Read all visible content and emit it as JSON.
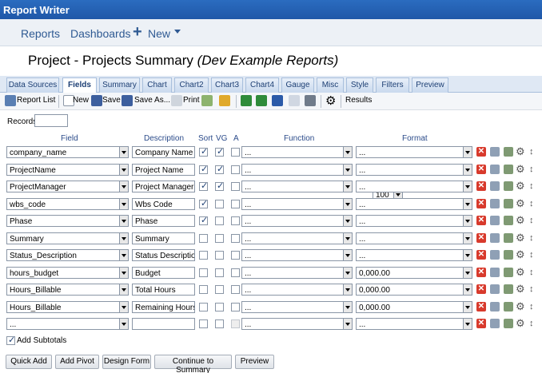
{
  "app_title": "Report Writer",
  "nav": {
    "reports": "Reports",
    "dashboards": "Dashboards",
    "new": "New"
  },
  "page_title_main": "Project - Projects Summary ",
  "page_title_sub": "(Dev Example Reports)",
  "tabs": [
    "Data Sources",
    "Fields",
    "Summary",
    "Chart",
    "Chart2",
    "Chart3",
    "Chart4",
    "Gauge",
    "Misc",
    "Style",
    "Filters",
    "Preview"
  ],
  "toolbar": {
    "report_list": "Report List",
    "new": "New",
    "save": "Save",
    "save_as": "Save As...",
    "print": "Print",
    "results_label": "Results",
    "results_value": "100"
  },
  "records_label": "Records",
  "headers": {
    "field": "Field",
    "description": "Description",
    "sort": "Sort",
    "vg": "VG",
    "a": "A",
    "function": "Function",
    "format": "Format"
  },
  "rows": [
    {
      "field": "company_name",
      "description": "Company Name",
      "sort": true,
      "vg": true,
      "a": false,
      "function": "...",
      "format": "..."
    },
    {
      "field": "ProjectName",
      "description": "Project Name",
      "sort": true,
      "vg": true,
      "a": false,
      "function": "...",
      "format": "..."
    },
    {
      "field": "ProjectManager",
      "description": "Project Manager",
      "sort": true,
      "vg": true,
      "a": false,
      "function": "...",
      "format": "..."
    },
    {
      "field": "wbs_code",
      "description": "Wbs Code",
      "sort": true,
      "vg": false,
      "a": false,
      "function": "...",
      "format": "..."
    },
    {
      "field": "Phase",
      "description": "Phase",
      "sort": true,
      "vg": false,
      "a": false,
      "function": "...",
      "format": "..."
    },
    {
      "field": "Summary",
      "description": "Summary",
      "sort": false,
      "vg": false,
      "a": false,
      "function": "...",
      "format": "..."
    },
    {
      "field": "Status_Description",
      "description": "Status Description",
      "sort": false,
      "vg": false,
      "a": false,
      "function": "...",
      "format": "..."
    },
    {
      "field": "hours_budget",
      "description": "Budget",
      "sort": false,
      "vg": false,
      "a": false,
      "function": "...",
      "format": "0,000.00"
    },
    {
      "field": "Hours_Billable",
      "description": "Total Hours",
      "sort": false,
      "vg": false,
      "a": false,
      "function": "...",
      "format": "0,000.00"
    },
    {
      "field": "Hours_Billable",
      "description": "Remaining Hours",
      "sort": false,
      "vg": false,
      "a": false,
      "function": "...",
      "format": "0,000.00"
    },
    {
      "field": "...",
      "description": "",
      "sort": false,
      "vg": false,
      "a": false,
      "function": "...",
      "format": "..."
    }
  ],
  "add_subtotals_label": "Add Subtotals",
  "buttons": {
    "quick_add": "Quick Add",
    "add_pivot": "Add Pivot",
    "design_form": "Design Form",
    "continue": "Continue to Summary",
    "preview": "Preview"
  },
  "colors": {
    "titlebar": "#1f57a8",
    "nav_link": "#2f5a93",
    "header_text": "#2b4b8a",
    "delete": "#d83a2c"
  }
}
